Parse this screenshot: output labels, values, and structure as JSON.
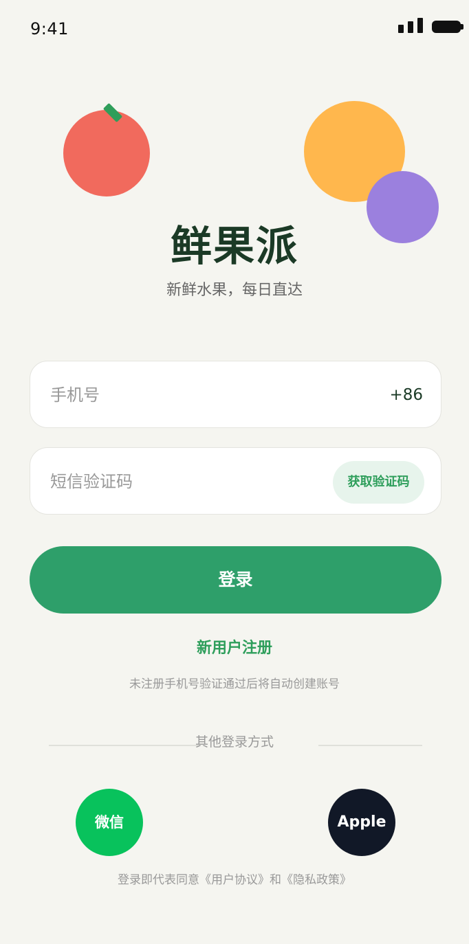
{
  "status_bar": {
    "time": "9:41"
  },
  "brand": {
    "title": "鲜果派",
    "subtitle": "新鲜水果，每日直达"
  },
  "form": {
    "phone_placeholder": "手机号",
    "country_code": "+86",
    "code_placeholder": "短信验证码",
    "get_code_label": "获取验证码",
    "login_label": "登录",
    "register_label": "新用户注册",
    "register_hint": "未注册手机号验证通过后将自动创建账号"
  },
  "other_login": {
    "label": "其他登录方式",
    "wechat_label": "微信",
    "apple_label": "Apple"
  },
  "agreement": "登录即代表同意《用户协议》和《隐私政策》",
  "colors": {
    "primary": "#2e9f6a",
    "background": "#f5f5f0",
    "wechat": "#08c25c",
    "apple": "#111827"
  }
}
